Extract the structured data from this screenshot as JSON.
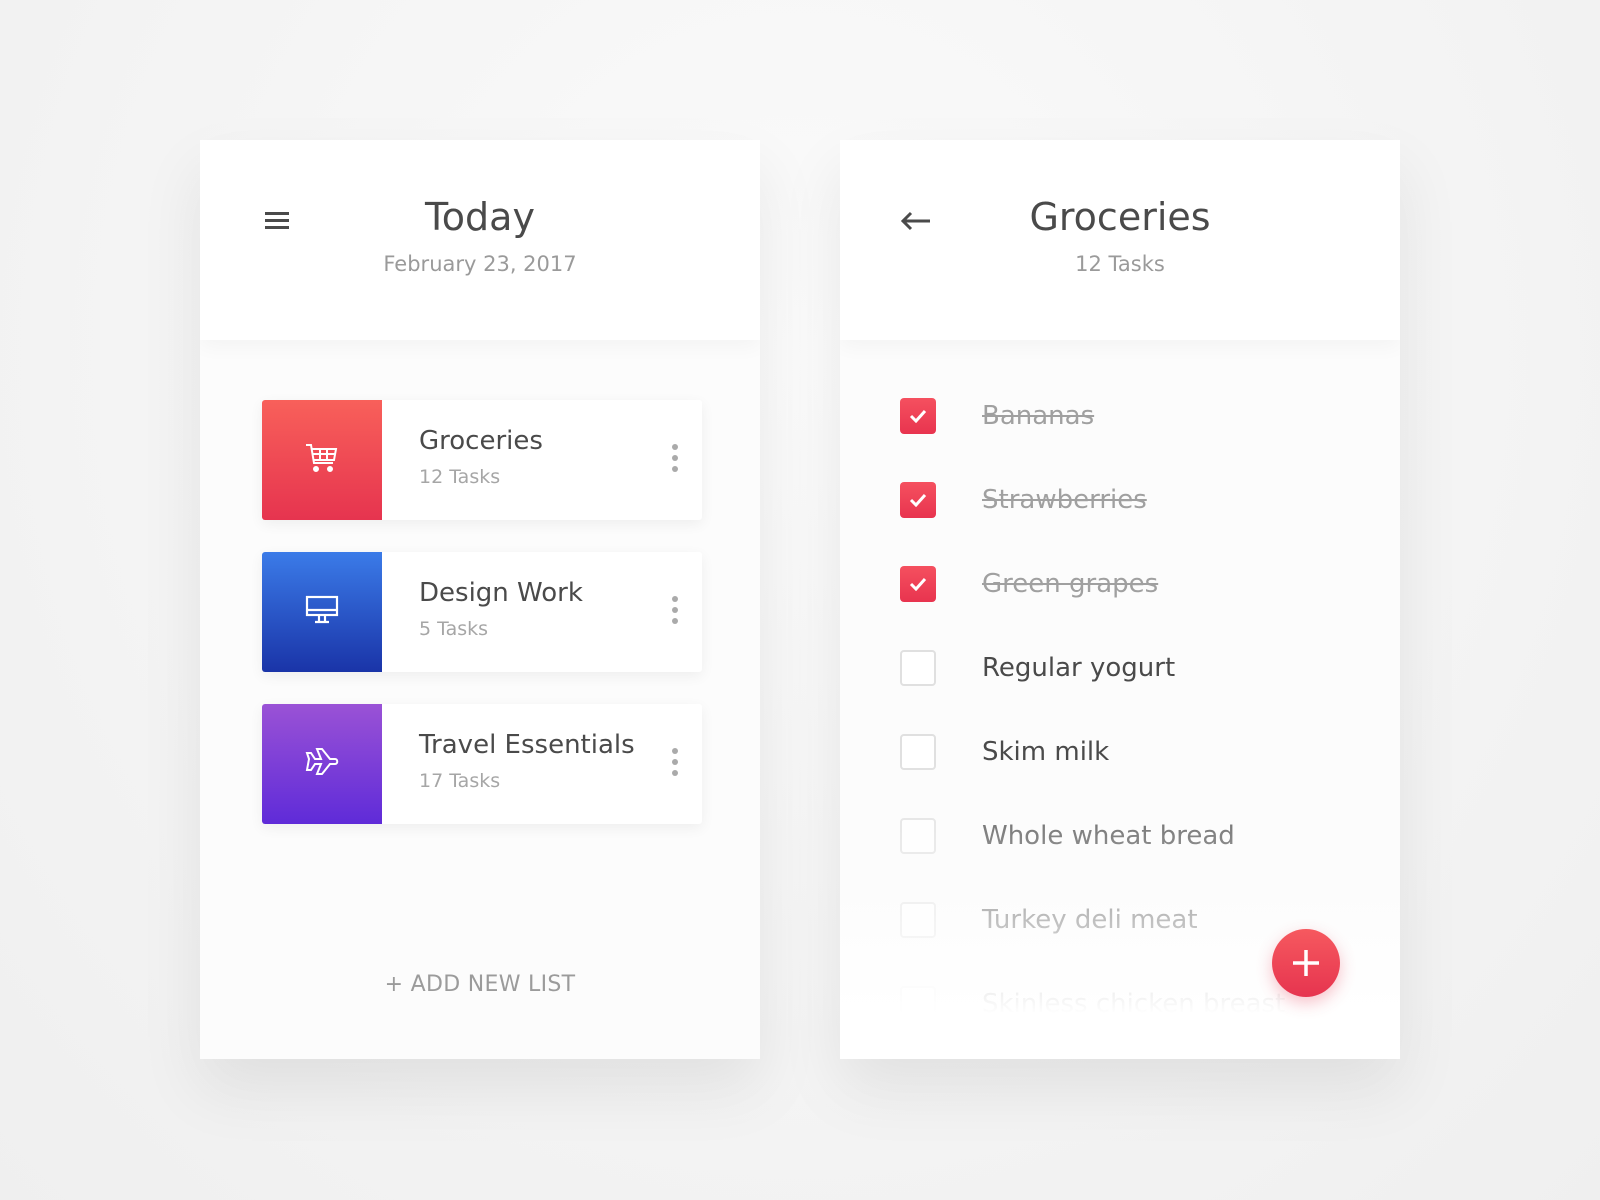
{
  "today": {
    "title": "Today",
    "date": "February 23, 2017",
    "menu_icon": "hamburger-icon",
    "lists": [
      {
        "name": "Groceries",
        "count": "12 Tasks",
        "icon": "cart-icon",
        "colors": [
          "#f8605a",
          "#e6344f"
        ]
      },
      {
        "name": "Design Work",
        "count": "5 Tasks",
        "icon": "monitor-icon",
        "colors": [
          "#3b7be8",
          "#1a34a8"
        ]
      },
      {
        "name": "Travel Essentials",
        "count": "17 Tasks",
        "icon": "airplane-icon",
        "colors": [
          "#9a52d6",
          "#5f2bd8"
        ]
      }
    ],
    "add_label": "+ ADD NEW LIST"
  },
  "groceries": {
    "title": "Groceries",
    "count": "12 Tasks",
    "back_icon": "arrow-left-icon",
    "items": [
      {
        "label": "Bananas",
        "checked": true
      },
      {
        "label": "Strawberries",
        "checked": true
      },
      {
        "label": "Green grapes",
        "checked": true
      },
      {
        "label": "Regular yogurt",
        "checked": false
      },
      {
        "label": "Skim milk",
        "checked": false
      },
      {
        "label": "Whole wheat bread",
        "checked": false
      },
      {
        "label": "Turkey deli meat",
        "checked": false
      },
      {
        "label": "Skinless chicken breast",
        "checked": false
      }
    ],
    "accent": "#ec3d55"
  }
}
